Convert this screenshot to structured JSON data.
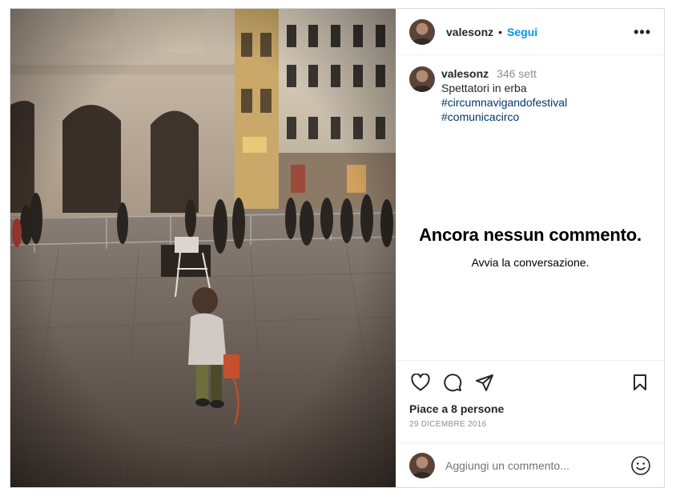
{
  "header": {
    "username": "valesonz",
    "separator": "•",
    "follow_label": "Segui",
    "more_icon": "more-options-icon"
  },
  "caption": {
    "username": "valesonz",
    "time": "346 sett",
    "text": "Spettatori in erba",
    "hashtags": [
      "#circumnavigandofestival",
      "#comunicacirco"
    ]
  },
  "comments": {
    "empty_title": "Ancora nessun commento.",
    "empty_subtitle": "Avvia la conversazione."
  },
  "actions": {
    "icons": [
      "heart-icon",
      "comment-icon",
      "share-icon",
      "bookmark-icon"
    ],
    "likes": "Piace a 8 persone",
    "date": "29 DICEMBRE 2016"
  },
  "add_comment": {
    "placeholder": "Aggiungi un commento...",
    "emoji_icon": "emoji-icon"
  },
  "colors": {
    "link": "#0095f6",
    "hashtag": "#00376b",
    "muted": "#8e8e8e"
  }
}
